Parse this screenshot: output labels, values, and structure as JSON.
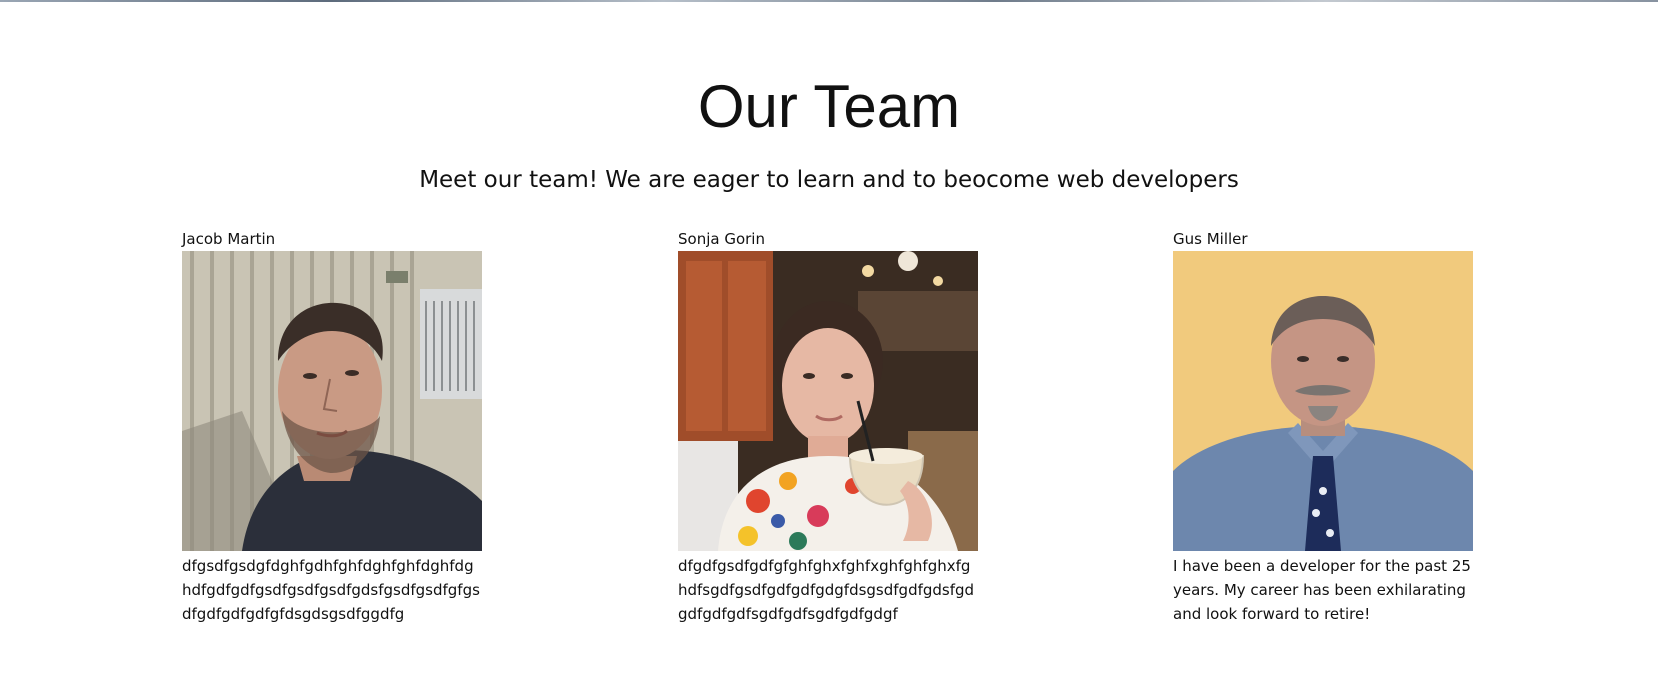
{
  "header": {
    "title": "Our Team",
    "subtitle": "Meet our team! We are eager to learn and to beocome web developers"
  },
  "team": [
    {
      "name": "Jacob Martin",
      "photo_alt": "Jacob Martin",
      "bio": "dfgsdfgsdgfdghfgdhfghfdghfghfdghfdghdfgdfgdfgsdfgsdfgsdfgdsfgsdfgsdfgfgsdfgdfgdfgdfgfdsgdsgsdfggdfg"
    },
    {
      "name": "Sonja Gorin",
      "photo_alt": "Sonja Gorin",
      "bio": "dfgdfgsdfgdfgfghfghxfghfxghfghfghxfghdfsgdfgsdfgdfgdfgdgfdsgsdfgdfgdsfgdgdfgdfgdfsgdfgdfsgdfgdfgdgf"
    },
    {
      "name": "Gus Miller",
      "photo_alt": "Gus Miller",
      "bio": "I have been a developer for the past 25 years. My career has been exhilarating and look forward to retire!"
    }
  ],
  "colors": {
    "background": "#ffffff",
    "text": "#111111"
  }
}
